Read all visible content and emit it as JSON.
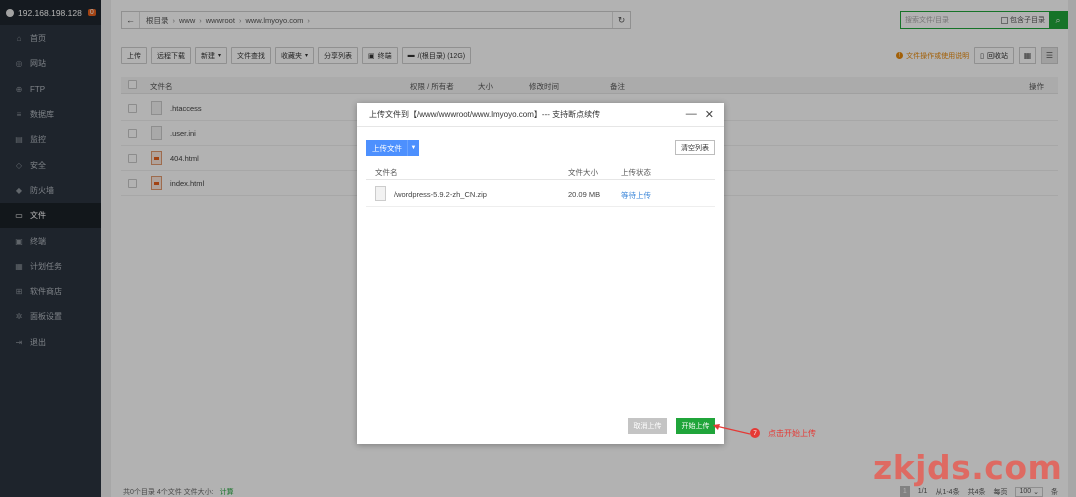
{
  "sidebar": {
    "server_ip": "192.168.198.128",
    "badge": "0",
    "items": [
      {
        "label": "首页",
        "icon": "home-icon"
      },
      {
        "label": "网站",
        "icon": "globe-icon"
      },
      {
        "label": "FTP",
        "icon": "ftp-icon"
      },
      {
        "label": "数据库",
        "icon": "database-icon"
      },
      {
        "label": "监控",
        "icon": "monitor-icon"
      },
      {
        "label": "安全",
        "icon": "shield-icon"
      },
      {
        "label": "防火墙",
        "icon": "firewall-icon"
      },
      {
        "label": "文件",
        "icon": "folder-icon",
        "active": true
      },
      {
        "label": "终端",
        "icon": "terminal-icon"
      },
      {
        "label": "计划任务",
        "icon": "calendar-icon"
      },
      {
        "label": "软件商店",
        "icon": "apps-icon"
      },
      {
        "label": "面板设置",
        "icon": "gear-icon"
      },
      {
        "label": "退出",
        "icon": "logout-icon"
      }
    ]
  },
  "path": {
    "crumbs": [
      "根目录",
      "www",
      "wwwroot",
      "www.lmyoyo.com"
    ]
  },
  "search": {
    "placeholder": "搜索文件/目录",
    "subdir_label": "包含子目录"
  },
  "toolbar": {
    "upload": "上传",
    "remote_download": "远程下载",
    "new": "新建",
    "file_search": "文件查找",
    "favorites": "收藏夹",
    "share_list": "分享列表",
    "terminal": "终端",
    "disk": "/(根目录) (12G)",
    "tip": "文件操作或使用说明",
    "recycle": "回收站"
  },
  "table": {
    "headers": {
      "name": "文件名",
      "perm": "权限 / 所有者",
      "size": "大小",
      "mtime": "修改时间",
      "note": "备注",
      "ops": "操作"
    },
    "rows": [
      {
        "name": ".htaccess",
        "type": "file"
      },
      {
        "name": ".user.ini",
        "type": "file"
      },
      {
        "name": "404.html",
        "type": "html"
      },
      {
        "name": "index.html",
        "type": "html"
      }
    ]
  },
  "footer": {
    "summary": "共0个目录 4个文件 文件大小:",
    "calc": "计算",
    "page_current": "1",
    "page_info": "1/1",
    "range": "从1-4条",
    "total": "共4条",
    "per_page_label": "每页",
    "per_page": "100",
    "per_page_unit": "条"
  },
  "dialog": {
    "title": "上传文件到【/www/wwwroot/www.lmyoyo.com】--- 支持断点续传",
    "upload_button": "上传文件",
    "clear_button": "清空列表",
    "headers": {
      "name": "文件名",
      "size": "文件大小",
      "status": "上传状态"
    },
    "files": [
      {
        "name": "/wordpress-5.9.2-zh_CN.zip",
        "size": "20.09 MB",
        "status": "等待上传"
      }
    ],
    "cancel": "取消上传",
    "start": "开始上传"
  },
  "annotation": {
    "number": "7",
    "text": "点击开始上传"
  },
  "watermark": "zkjds.com"
}
